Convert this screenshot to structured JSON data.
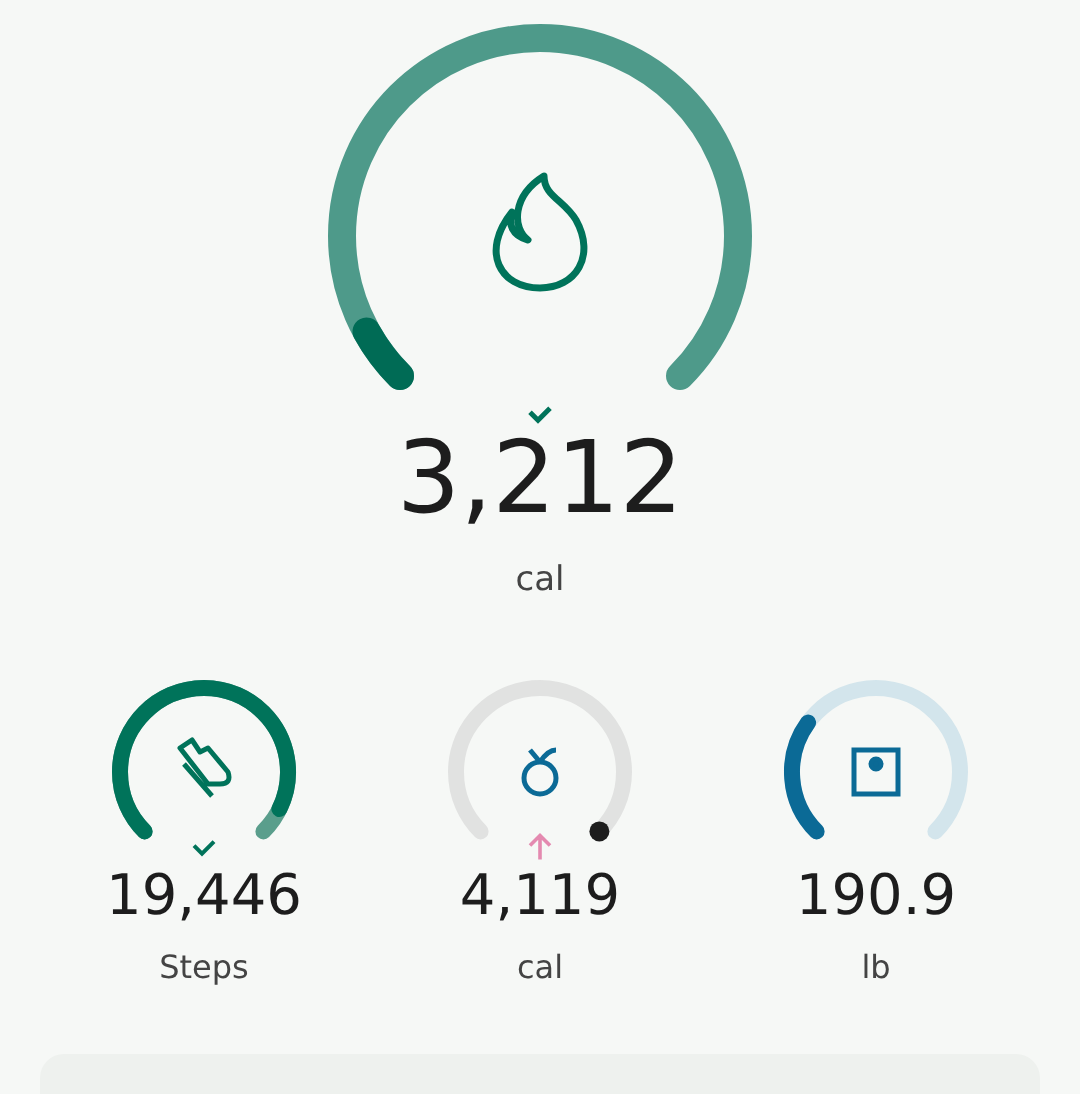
{
  "main": {
    "value": "3,212",
    "unit": "cal"
  },
  "metrics": [
    {
      "kind": "steps",
      "value": "19,446",
      "unit": "Steps"
    },
    {
      "kind": "food",
      "value": "4,119",
      "unit": "cal"
    },
    {
      "kind": "weight",
      "value": "190.9",
      "unit": "lb"
    }
  ]
}
